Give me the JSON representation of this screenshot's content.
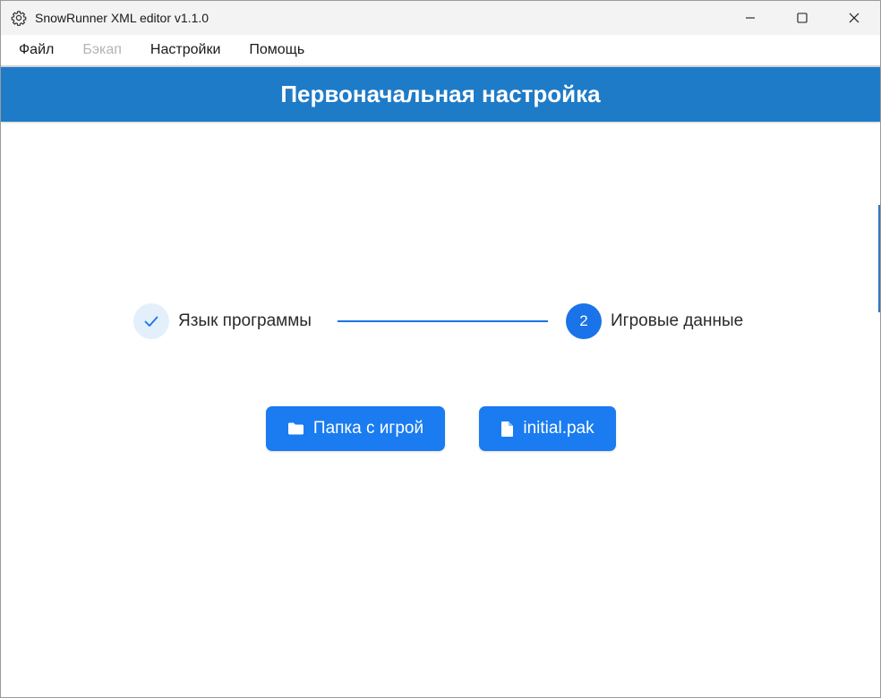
{
  "window": {
    "title": "SnowRunner XML editor v1.1.0"
  },
  "menu": {
    "items": [
      {
        "label": "Файл",
        "enabled": true
      },
      {
        "label": "Бэкап",
        "enabled": false
      },
      {
        "label": "Настройки",
        "enabled": true
      },
      {
        "label": "Помощь",
        "enabled": true
      }
    ]
  },
  "header": {
    "title": "Первоначальная настройка"
  },
  "stepper": {
    "steps": [
      {
        "label": "Язык программы",
        "state": "done",
        "icon": "check-icon"
      },
      {
        "label": "Игровые данные",
        "state": "active",
        "number": "2"
      }
    ]
  },
  "actions": {
    "game_folder_label": "Папка с игрой",
    "game_folder_icon": "folder-icon",
    "initial_pak_label": "initial.pak",
    "initial_pak_icon": "file-icon"
  },
  "colors": {
    "header_bg": "#1e7bc8",
    "accent": "#1a73e8",
    "button_bg": "#1a7cf0",
    "step_done_bg": "#e3f0fc"
  }
}
